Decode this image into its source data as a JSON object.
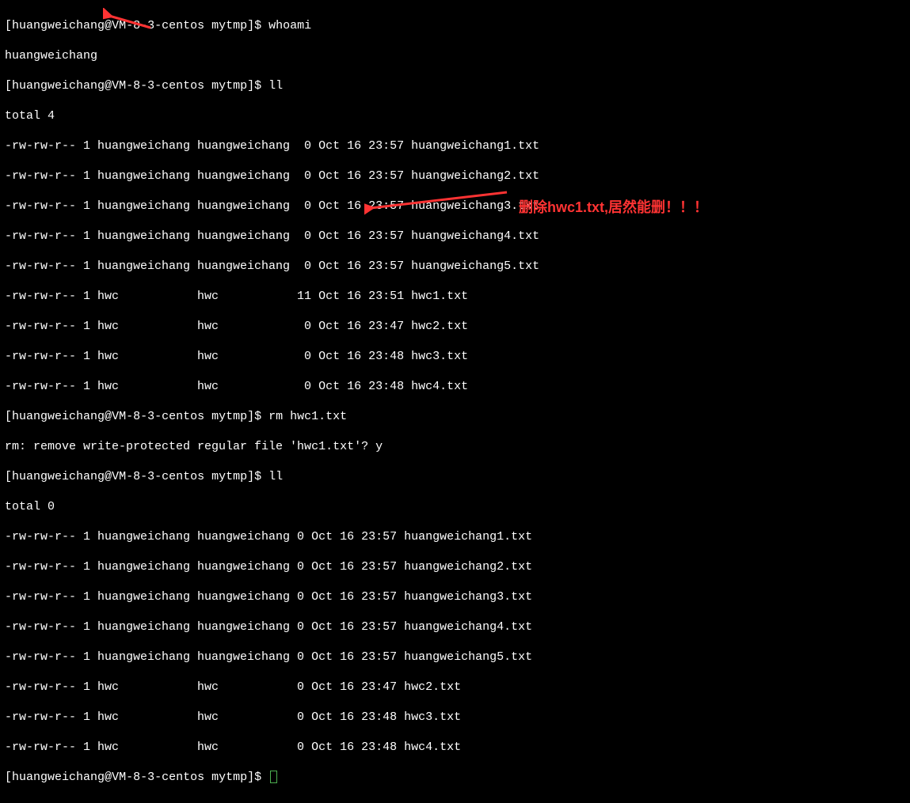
{
  "prompt": {
    "user": "huangweichang",
    "host": "VM-8-3-centos",
    "cwd": "mytmp",
    "symbol": "$"
  },
  "cmds": {
    "whoami": "whoami",
    "whoami_out": "huangweichang",
    "ll1": "ll",
    "total1": "total 4",
    "ls1": [
      "-rw-rw-r-- 1 huangweichang huangweichang  0 Oct 16 23:57 huangweichang1.txt",
      "-rw-rw-r-- 1 huangweichang huangweichang  0 Oct 16 23:57 huangweichang2.txt",
      "-rw-rw-r-- 1 huangweichang huangweichang  0 Oct 16 23:57 huangweichang3.txt",
      "-rw-rw-r-- 1 huangweichang huangweichang  0 Oct 16 23:57 huangweichang4.txt",
      "-rw-rw-r-- 1 huangweichang huangweichang  0 Oct 16 23:57 huangweichang5.txt",
      "-rw-rw-r-- 1 hwc           hwc           11 Oct 16 23:51 hwc1.txt",
      "-rw-rw-r-- 1 hwc           hwc            0 Oct 16 23:47 hwc2.txt",
      "-rw-rw-r-- 1 hwc           hwc            0 Oct 16 23:48 hwc3.txt",
      "-rw-rw-r-- 1 hwc           hwc            0 Oct 16 23:48 hwc4.txt"
    ],
    "rm": "rm hwc1.txt",
    "rm_prompt": "rm: remove write-protected regular file 'hwc1.txt'? y",
    "ll2": "ll",
    "total2": "total 0",
    "ls2": [
      "-rw-rw-r-- 1 huangweichang huangweichang 0 Oct 16 23:57 huangweichang1.txt",
      "-rw-rw-r-- 1 huangweichang huangweichang 0 Oct 16 23:57 huangweichang2.txt",
      "-rw-rw-r-- 1 huangweichang huangweichang 0 Oct 16 23:57 huangweichang3.txt",
      "-rw-rw-r-- 1 huangweichang huangweichang 0 Oct 16 23:57 huangweichang4.txt",
      "-rw-rw-r-- 1 huangweichang huangweichang 0 Oct 16 23:57 huangweichang5.txt",
      "-rw-rw-r-- 1 hwc           hwc           0 Oct 16 23:47 hwc2.txt",
      "-rw-rw-r-- 1 hwc           hwc           0 Oct 16 23:48 hwc3.txt",
      "-rw-rw-r-- 1 hwc           hwc           0 Oct 16 23:48 hwc4.txt"
    ]
  },
  "annotation": "删除hwc1.txt,居然能删！！！"
}
